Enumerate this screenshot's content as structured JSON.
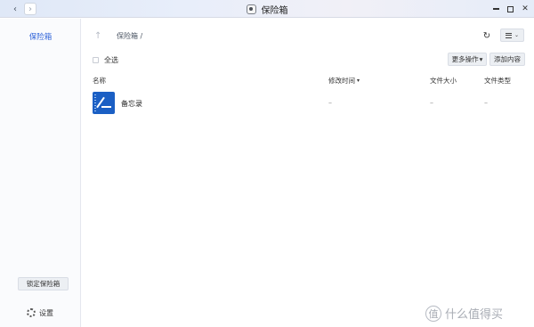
{
  "window": {
    "title": "保险箱",
    "back_glyph": "‹",
    "forward_glyph": "›",
    "close_glyph": "✕"
  },
  "sidebar": {
    "items": [
      {
        "label": "保险箱",
        "active": true
      }
    ],
    "lock_button": "锁定保险箱",
    "settings_label": "设置"
  },
  "toolbar": {
    "path": "保险箱 /",
    "up_glyph": "↑",
    "refresh_glyph": "↻",
    "view_caret": "⌄"
  },
  "actions": {
    "select_all": "全选",
    "more": "更多操作",
    "more_caret": "▾",
    "add": "添加内容"
  },
  "table": {
    "columns": {
      "name": "名称",
      "modified": "修改时间",
      "size": "文件大小",
      "type": "文件类型"
    },
    "sort_caret": "▾",
    "rows": [
      {
        "name": "备忘录",
        "modified": "–",
        "size": "–",
        "type": "–"
      }
    ]
  },
  "watermark": {
    "badge": "值",
    "text": "什么值得买"
  },
  "colors": {
    "accent": "#2f63d9",
    "file_icon": "#1b5fc4"
  }
}
